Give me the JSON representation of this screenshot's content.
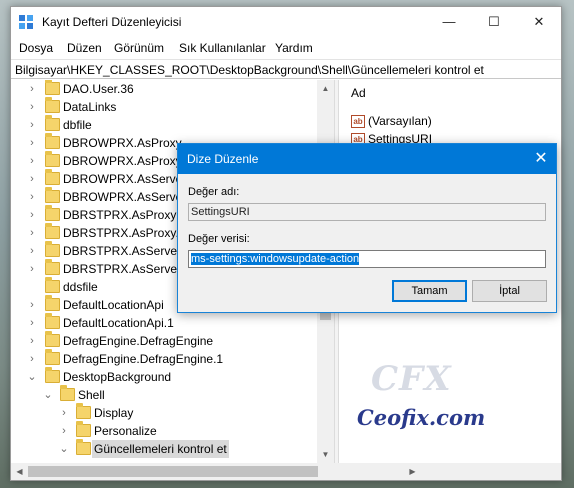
{
  "window": {
    "title": "Kayıt Defteri Düzenleyicisi",
    "controls": {
      "minimize": "—",
      "maximize": "☐",
      "close": "✕"
    }
  },
  "menu": [
    "Dosya",
    "Düzen",
    "Görünüm",
    "Sık Kullanılanlar",
    "Yardım"
  ],
  "address": "Bilgisayar\\HKEY_CLASSES_ROOT\\DesktopBackground\\Shell\\Güncellemeleri kontrol et",
  "tree": [
    {
      "label": "DAO.User.36",
      "chevron": "›"
    },
    {
      "label": "DataLinks",
      "chevron": "›"
    },
    {
      "label": "dbfile",
      "chevron": "›"
    },
    {
      "label": "DBROWPRX.AsProxy",
      "chevron": "›"
    },
    {
      "label": "DBROWPRX.AsProxy.1",
      "chevron": "›"
    },
    {
      "label": "DBROWPRX.AsServer",
      "chevron": "›"
    },
    {
      "label": "DBROWPRX.AsServer.1",
      "chevron": "›"
    },
    {
      "label": "DBRSTPRX.AsProxy",
      "chevron": "›"
    },
    {
      "label": "DBRSTPRX.AsProxy.1",
      "chevron": "›"
    },
    {
      "label": "DBRSTPRX.AsServer",
      "chevron": "›"
    },
    {
      "label": "DBRSTPRX.AsServer.1",
      "chevron": "›"
    },
    {
      "label": "ddsfile",
      "chevron": ""
    },
    {
      "label": "DefaultLocationApi",
      "chevron": "›"
    },
    {
      "label": "DefaultLocationApi.1",
      "chevron": "›"
    },
    {
      "label": "DefragEngine.DefragEngine",
      "chevron": "›"
    },
    {
      "label": "DefragEngine.DefragEngine.1",
      "chevron": "›"
    },
    {
      "label": "DesktopBackground",
      "chevron": "⌄"
    },
    {
      "label": "Shell",
      "chevron": "⌄"
    },
    {
      "label": "Display",
      "chevron": "›"
    },
    {
      "label": "Personalize",
      "chevron": "›"
    },
    {
      "label": "Güncellemeleri kontrol et",
      "chevron": "⌄"
    }
  ],
  "values_header": "Ad",
  "values": [
    {
      "icon": "ab",
      "name": "(Varsayılan)"
    },
    {
      "icon": "ab",
      "name": "SettingsURI"
    }
  ],
  "watermark": {
    "logo": "CFX",
    "text": "Ceofix.com"
  },
  "dialog": {
    "title": "Dize Düzenle",
    "name_label": "Değer adı:",
    "name_value": "SettingsURI",
    "data_label": "Değer verisi:",
    "data_value": "ms-settings:windowsupdate-action",
    "ok": "Tamam",
    "cancel": "İptal"
  },
  "colors": {
    "accent": "#0078d7",
    "folder": "#f5d46b"
  }
}
